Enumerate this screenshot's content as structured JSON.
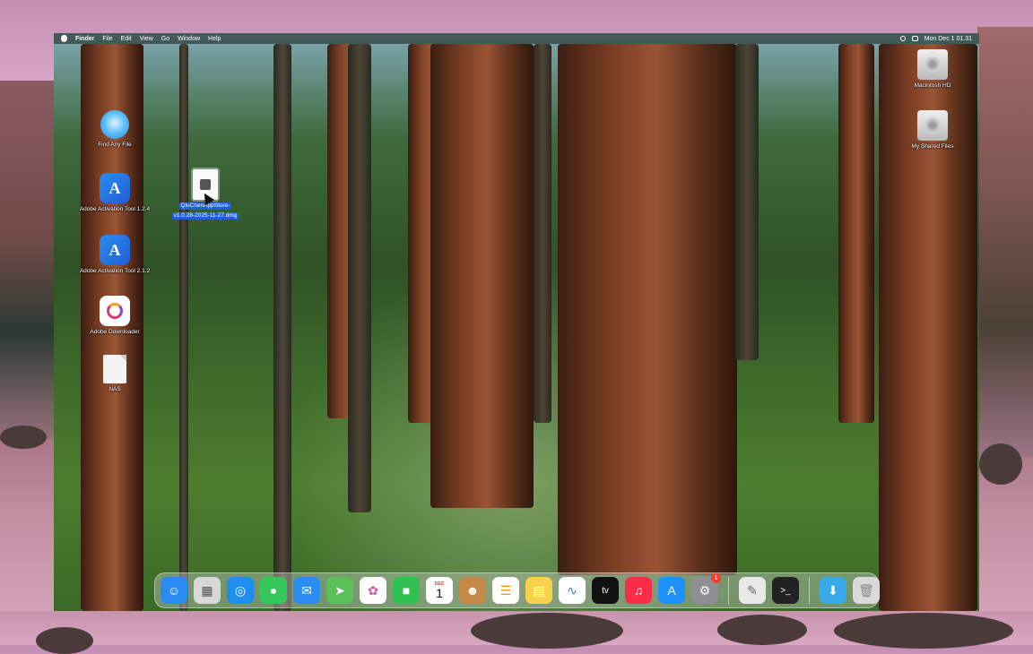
{
  "menubar": {
    "app_name": "Finder",
    "menus": [
      "File",
      "Edit",
      "View",
      "Go",
      "Window",
      "Help"
    ],
    "datetime": "Mon Dec 1  01.31"
  },
  "desktop": {
    "left_icons": [
      {
        "label": "Find Any File",
        "icon": "finder-file-icon"
      },
      {
        "label": "Adobe Activation Tool 1.2.4",
        "icon": "adobe-activation-icon"
      },
      {
        "label": "Adobe Activation Tool 2.1.2",
        "icon": "adobe-activation-icon"
      },
      {
        "label": "Adobe Downloader",
        "icon": "creative-cloud-icon"
      },
      {
        "label": "NAS",
        "icon": "document-icon"
      }
    ],
    "selected_file": {
      "line1": "QiuChenAppStore-",
      "line2": "v1.0.28-2025-11-27.dmg",
      "icon": "dmg-file-icon"
    },
    "right_icons": [
      {
        "label": "Macintosh HD",
        "icon": "hard-drive-icon"
      },
      {
        "label": "My Shared Files",
        "icon": "hard-drive-icon"
      }
    ]
  },
  "dock": {
    "apps": [
      {
        "name": "finder",
        "icon": "finder-icon",
        "color": "#2a8bf2"
      },
      {
        "name": "launchpad",
        "icon": "launchpad-icon",
        "color": "#d8d8d8"
      },
      {
        "name": "safari",
        "icon": "safari-icon",
        "color": "#1e8ef0"
      },
      {
        "name": "messages",
        "icon": "messages-icon",
        "color": "#34c759"
      },
      {
        "name": "mail",
        "icon": "mail-icon",
        "color": "#2b8cf2"
      },
      {
        "name": "maps",
        "icon": "maps-icon",
        "color": "#5bbf5a"
      },
      {
        "name": "photos",
        "icon": "photos-icon",
        "color": "#ffffff"
      },
      {
        "name": "facetime",
        "icon": "facetime-icon",
        "color": "#30c04f"
      },
      {
        "name": "calendar",
        "icon": "calendar-icon",
        "month": "DEC",
        "day": "1"
      },
      {
        "name": "contacts",
        "icon": "contacts-icon",
        "color": "#c58a4a"
      },
      {
        "name": "reminders",
        "icon": "reminders-icon",
        "color": "#ffffff"
      },
      {
        "name": "notes",
        "icon": "notes-icon",
        "color": "#f7d24a"
      },
      {
        "name": "freeform",
        "icon": "freeform-icon",
        "color": "#ffffff"
      },
      {
        "name": "apple-tv",
        "icon": "tv-icon",
        "label": "tv",
        "color": "#111111"
      },
      {
        "name": "music",
        "icon": "music-icon",
        "color": "#fa2d48"
      },
      {
        "name": "app-store",
        "icon": "app-store-icon",
        "color": "#1e90ff"
      },
      {
        "name": "system-settings",
        "icon": "gear-icon",
        "color": "#8e8e93",
        "badge": "1"
      },
      {
        "name": "text-edit",
        "icon": "textedit-icon",
        "color": "#e8e8e8"
      },
      {
        "name": "terminal",
        "icon": "terminal-icon",
        "color": "#222222"
      },
      {
        "name": "downloads",
        "icon": "downloads-folder-icon",
        "color": "#3aa9e8"
      },
      {
        "name": "trash",
        "icon": "trash-icon",
        "color": "#d9d9d9"
      }
    ]
  }
}
